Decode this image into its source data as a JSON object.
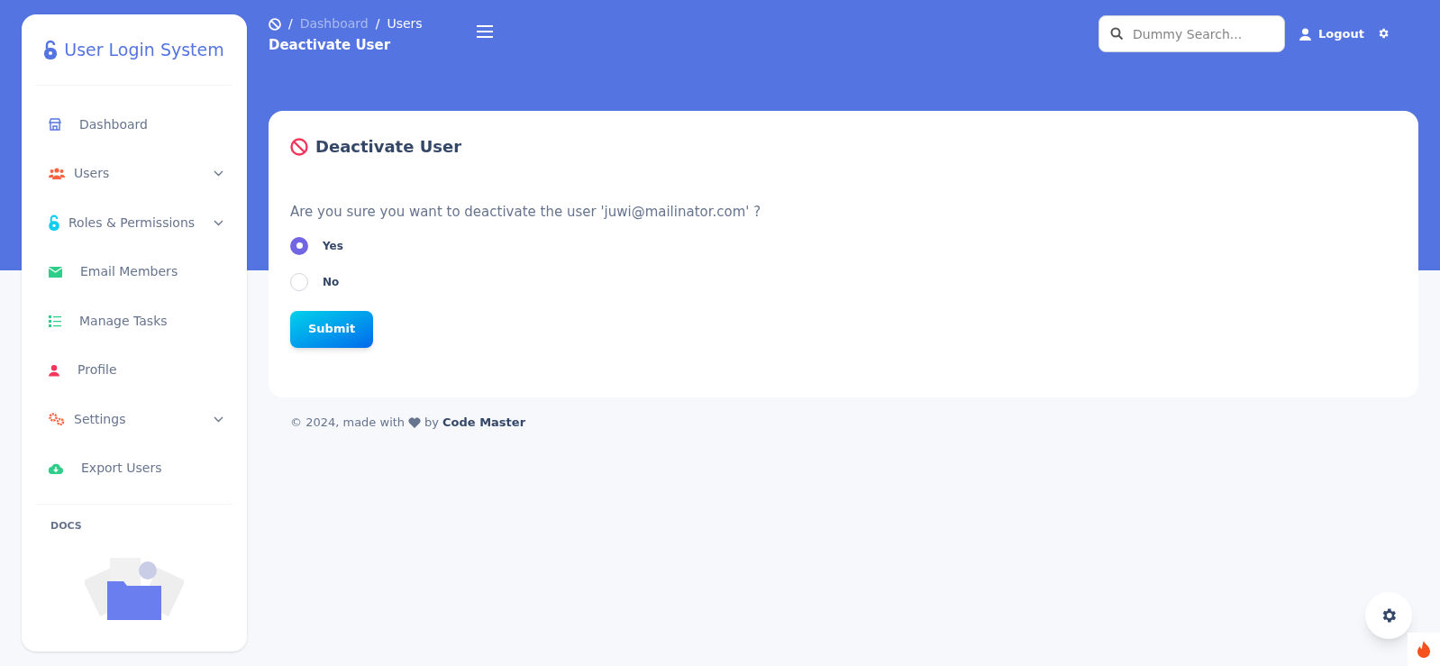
{
  "sidebar": {
    "brand": "User Login System",
    "items": [
      {
        "label": "Dashboard",
        "kind": "shop",
        "expandable": false
      },
      {
        "label": "Users",
        "kind": "users",
        "expandable": true
      },
      {
        "label": "Roles & Permissions",
        "kind": "lock",
        "expandable": true
      },
      {
        "label": "Email Members",
        "kind": "mail",
        "expandable": false
      },
      {
        "label": "Manage Tasks",
        "kind": "list",
        "expandable": false
      },
      {
        "label": "Profile",
        "kind": "user",
        "expandable": false
      },
      {
        "label": "Settings",
        "kind": "gears",
        "expandable": true
      },
      {
        "label": "Export Users",
        "kind": "cloud",
        "expandable": false
      }
    ],
    "section": "DOCS"
  },
  "header": {
    "breadcrumb": [
      {
        "separator": "/",
        "label": "Dashboard"
      },
      {
        "separator": "/",
        "label": "Users"
      }
    ],
    "title": "Deactivate User",
    "search": {
      "placeholder": "Dummy Search..."
    },
    "logout": "Logout"
  },
  "card": {
    "title": "Deactivate User",
    "question": "Are you sure you want to deactivate the user 'juwi@mailinator.com' ?",
    "options": [
      {
        "label": "Yes",
        "selected": true
      },
      {
        "label": "No",
        "selected": false
      }
    ],
    "submit": "Submit"
  },
  "footer": {
    "text": "© 2024, made with",
    "by": "by",
    "author": "Code Master"
  }
}
